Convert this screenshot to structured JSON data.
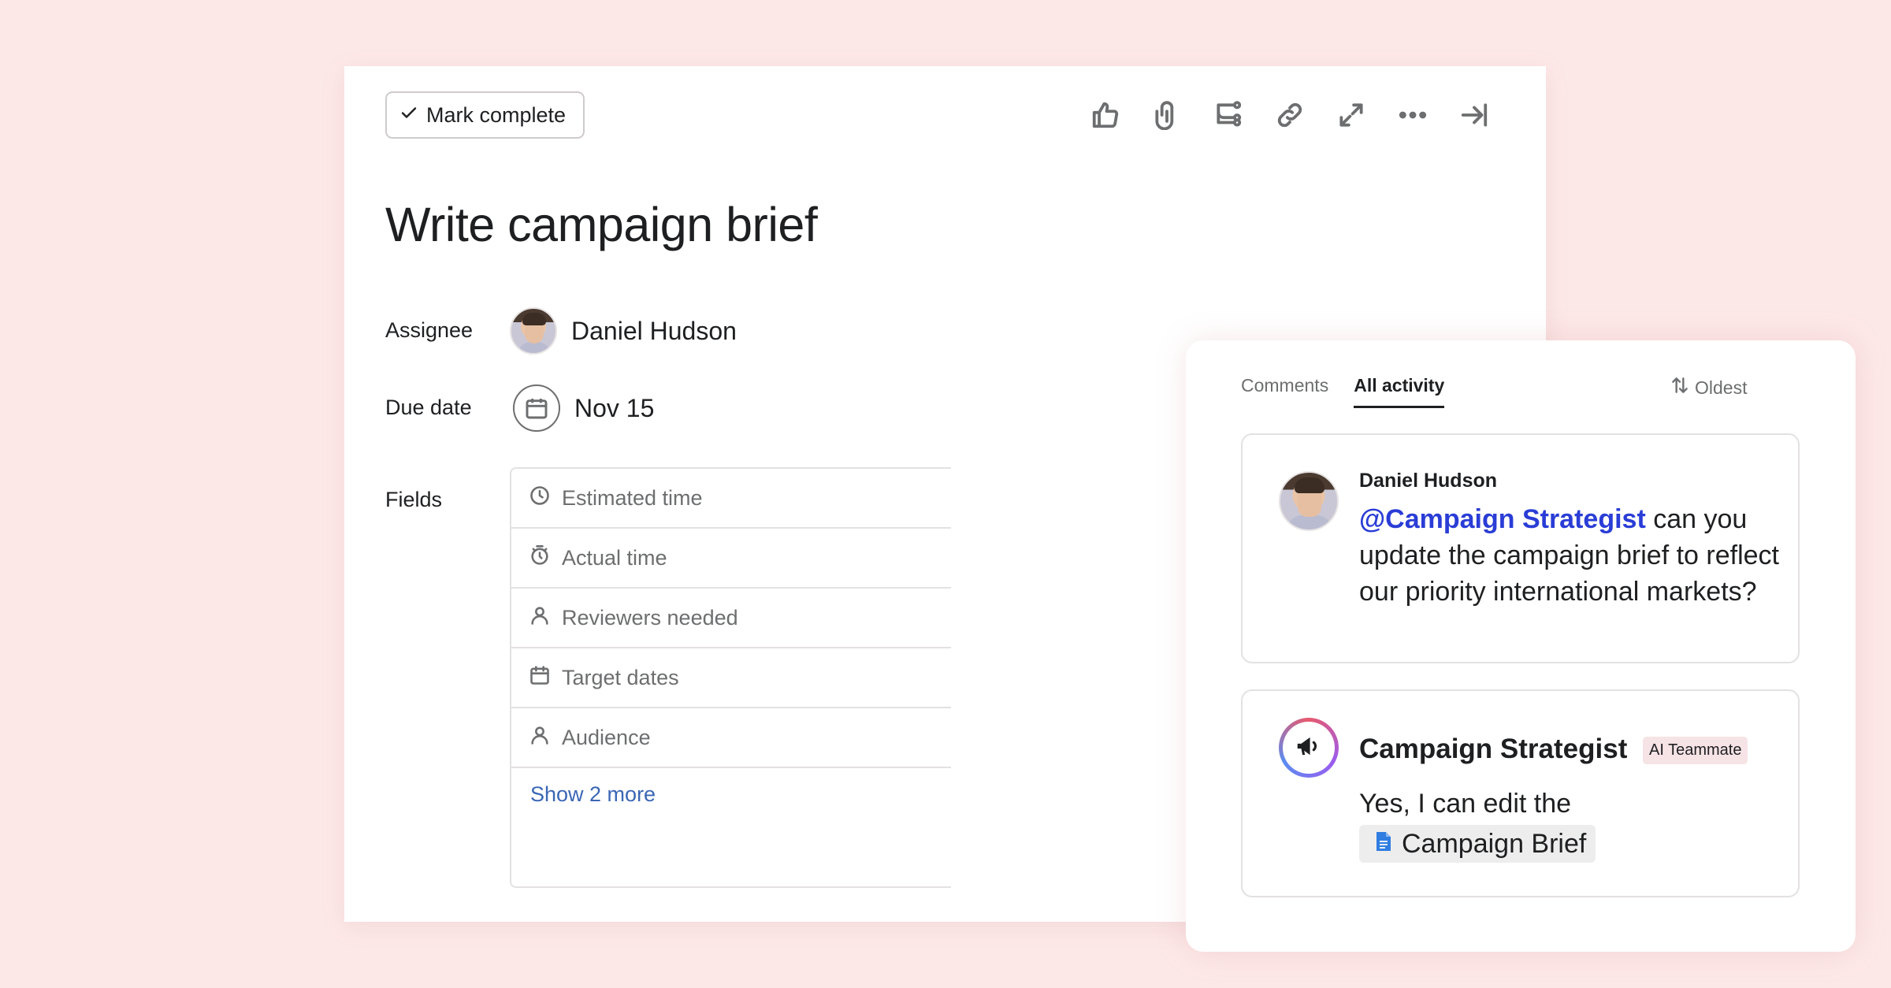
{
  "toolbar": {
    "mark_complete_label": "Mark complete",
    "icons": [
      "thumbs-up-icon",
      "paperclip-icon",
      "subtask-icon",
      "link-icon",
      "expand-icon",
      "more-icon",
      "close-panel-icon"
    ]
  },
  "task": {
    "title": "Write campaign brief",
    "assignee_label": "Assignee",
    "assignee_name": "Daniel Hudson",
    "due_date_label": "Due date",
    "due_date": "Nov 15",
    "fields_label": "Fields",
    "fields": [
      {
        "label": "Estimated time",
        "icon": "clock-icon"
      },
      {
        "label": "Actual time",
        "icon": "stopwatch-icon"
      },
      {
        "label": "Reviewers needed",
        "icon": "person-icon"
      },
      {
        "label": "Target dates",
        "icon": "calendar-icon"
      },
      {
        "label": "Audience",
        "icon": "person-icon"
      }
    ],
    "show_more": "Show 2 more"
  },
  "activity": {
    "tabs": [
      "Comments",
      "All activity"
    ],
    "active_tab": "All activity",
    "sort_label": "Oldest",
    "comments": [
      {
        "author": "Daniel Hudson",
        "mention": "@Campaign Strategist",
        "text": " can you update the campaign brief to reflect our priority international markets?"
      },
      {
        "author": "Campaign Strategist",
        "badge": "AI Teammate",
        "text": "Yes, I can edit the",
        "attachment": "Campaign Brief"
      }
    ]
  },
  "colors": {
    "background": "#fde8e8",
    "mention": "#2a3dd6",
    "link": "#3a66b5",
    "badge_bg": "#f6e3e6",
    "doc_icon": "#2f7de1"
  }
}
